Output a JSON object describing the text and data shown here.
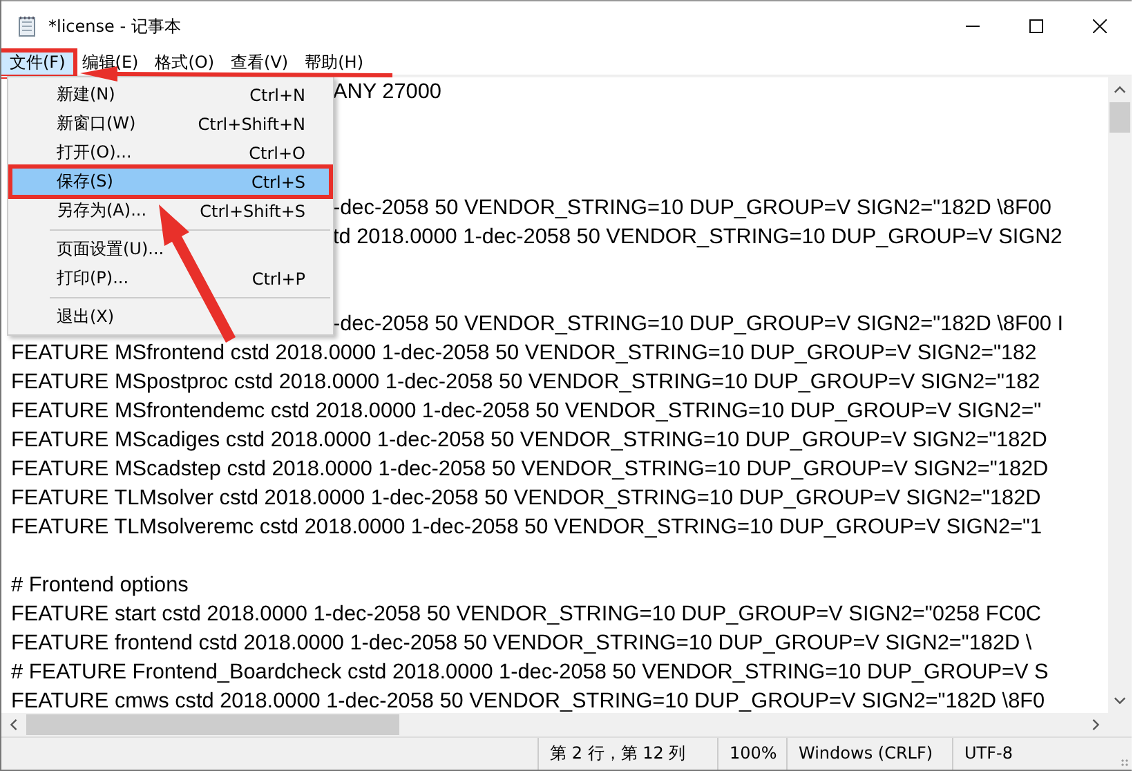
{
  "window": {
    "title": "*license - 记事本"
  },
  "menu_bar": [
    {
      "label": "文件(F)",
      "selected": true,
      "annotated": true
    },
    {
      "label": "编辑(E)",
      "selected": false,
      "annotated": false
    },
    {
      "label": "格式(O)",
      "selected": false,
      "annotated": false
    },
    {
      "label": "查看(V)",
      "selected": false,
      "annotated": false
    },
    {
      "label": "帮助(H)",
      "selected": false,
      "annotated": false
    }
  ],
  "file_menu": [
    {
      "kind": "item",
      "label": "新建(N)",
      "shortcut": "Ctrl+N",
      "selected": false,
      "annotated": false
    },
    {
      "kind": "item",
      "label": "新窗口(W)",
      "shortcut": "Ctrl+Shift+N",
      "selected": false,
      "annotated": false
    },
    {
      "kind": "item",
      "label": "打开(O)...",
      "shortcut": "Ctrl+O",
      "selected": false,
      "annotated": false
    },
    {
      "kind": "item",
      "label": "保存(S)",
      "shortcut": "Ctrl+S",
      "selected": true,
      "annotated": true
    },
    {
      "kind": "item",
      "label": "另存为(A)...",
      "shortcut": "Ctrl+Shift+S",
      "selected": false,
      "annotated": false
    },
    {
      "kind": "separator"
    },
    {
      "kind": "item",
      "label": "页面设置(U)...",
      "selected": false,
      "annotated": false
    },
    {
      "kind": "item",
      "label": "打印(P)...",
      "shortcut": "Ctrl+P",
      "selected": false,
      "annotated": false
    },
    {
      "kind": "separator"
    },
    {
      "kind": "item",
      "label": "退出(X)",
      "selected": false,
      "annotated": false
    }
  ],
  "editor_lines": [
    {
      "kind": "covered",
      "text": "ANY 27000"
    },
    {
      "kind": "blank"
    },
    {
      "kind": "blank"
    },
    {
      "kind": "blank"
    },
    {
      "kind": "covered",
      "text": "-dec-2058 50 VENDOR_STRING=10 DUP_GROUP=V SIGN2=\"182D \\8F00"
    },
    {
      "kind": "covered",
      "text": "td 2018.0000 1-dec-2058 50 VENDOR_STRING=10 DUP_GROUP=V SIGN2"
    },
    {
      "kind": "blank"
    },
    {
      "kind": "blank"
    },
    {
      "kind": "covered",
      "text": "-dec-2058 50 VENDOR_STRING=10 DUP_GROUP=V SIGN2=\"182D \\8F00 I"
    },
    {
      "kind": "full",
      "text": "FEATURE MSfrontend cstd 2018.0000 1-dec-2058 50 VENDOR_STRING=10 DUP_GROUP=V SIGN2=\"182"
    },
    {
      "kind": "full",
      "text": "FEATURE MSpostproc cstd 2018.0000 1-dec-2058 50 VENDOR_STRING=10 DUP_GROUP=V SIGN2=\"182"
    },
    {
      "kind": "full",
      "text": "FEATURE MSfrontendemc cstd 2018.0000 1-dec-2058 50 VENDOR_STRING=10 DUP_GROUP=V SIGN2=\""
    },
    {
      "kind": "full",
      "text": "FEATURE MScadiges cstd 2018.0000 1-dec-2058 50 VENDOR_STRING=10 DUP_GROUP=V SIGN2=\"182D"
    },
    {
      "kind": "full",
      "text": "FEATURE MScadstep cstd 2018.0000 1-dec-2058 50 VENDOR_STRING=10 DUP_GROUP=V SIGN2=\"182D"
    },
    {
      "kind": "full",
      "text": "FEATURE TLMsolver cstd 2018.0000 1-dec-2058 50 VENDOR_STRING=10 DUP_GROUP=V SIGN2=\"182D"
    },
    {
      "kind": "full",
      "text": "FEATURE TLMsolveremc cstd 2018.0000 1-dec-2058 50 VENDOR_STRING=10 DUP_GROUP=V SIGN2=\"1"
    },
    {
      "kind": "blank"
    },
    {
      "kind": "full",
      "text": "# Frontend options"
    },
    {
      "kind": "full",
      "text": "FEATURE start cstd 2018.0000 1-dec-2058 50 VENDOR_STRING=10 DUP_GROUP=V SIGN2=\"0258 FC0C"
    },
    {
      "kind": "full",
      "text": "FEATURE frontend cstd 2018.0000 1-dec-2058 50 VENDOR_STRING=10 DUP_GROUP=V SIGN2=\"182D \\"
    },
    {
      "kind": "full",
      "text": "# FEATURE Frontend_Boardcheck cstd 2018.0000 1-dec-2058 50 VENDOR_STRING=10 DUP_GROUP=V S"
    },
    {
      "kind": "full",
      "text": "FEATURE cmws cstd 2018.0000 1-dec-2058 50 VENDOR_STRING=10 DUP_GROUP=V SIGN2=\"182D \\8F0"
    }
  ],
  "status_bar": [
    "第 2 行，第 12 列",
    "100%",
    "Windows (CRLF)",
    "UTF-8"
  ],
  "annotations": [
    {
      "kind": "arrow"
    },
    {
      "kind": "arrow"
    }
  ]
}
